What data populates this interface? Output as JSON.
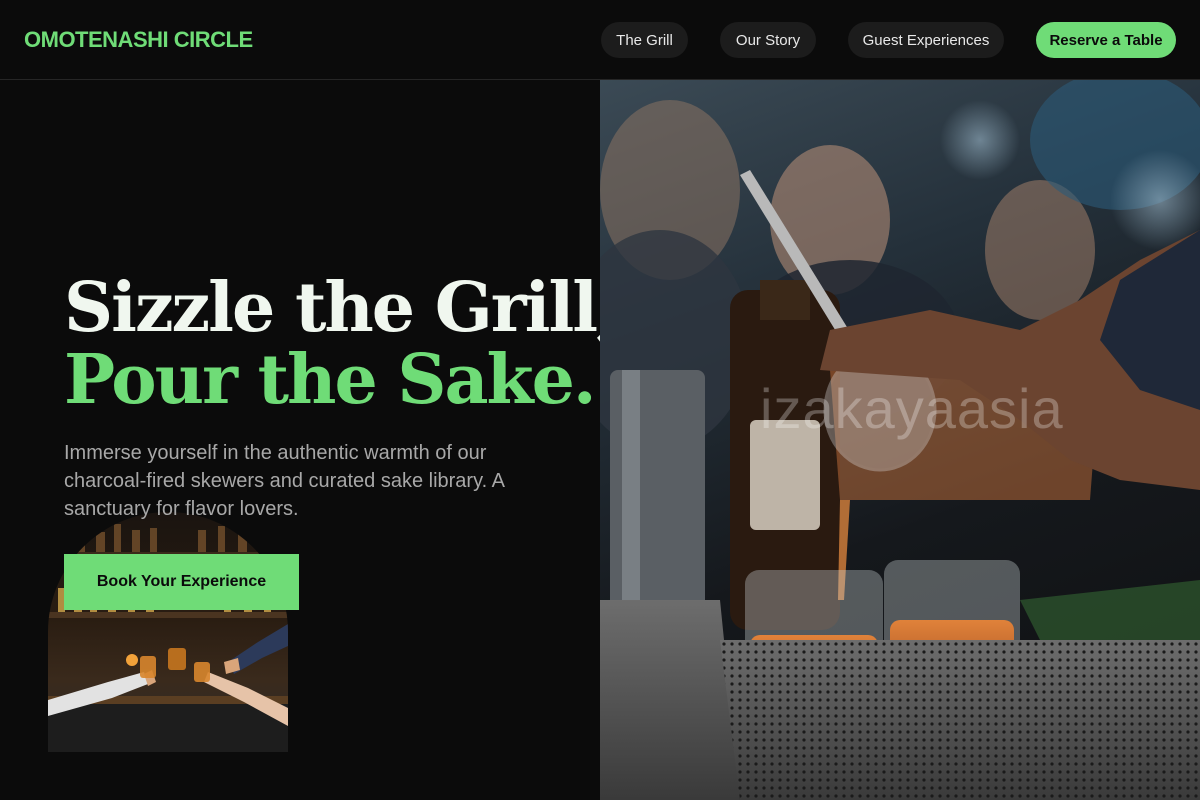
{
  "header": {
    "brand": "OMOTENASHI CIRCLE",
    "nav": [
      {
        "label": "The Grill"
      },
      {
        "label": "Our Story"
      },
      {
        "label": "Guest Experiences"
      }
    ],
    "cta_label": "Reserve a Table"
  },
  "hero": {
    "headline_line1": "Sizzle the Grill,",
    "headline_line2": "Pour the Sake.",
    "subtext": "Immerse yourself in the authentic warmth of our charcoal-fired skewers and curated sake library. A sanctuary for flavor lovers.",
    "cta_label": "Book Your Experience",
    "image_watermark": "izakayaasia"
  },
  "colors": {
    "accent": "#6fdc77",
    "background": "#0b0b0b",
    "headline": "#f0f7ef",
    "subtext": "#a8a8a8"
  }
}
